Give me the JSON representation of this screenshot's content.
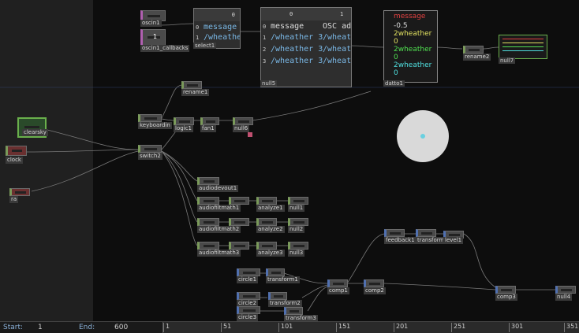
{
  "nodes": {
    "oscin1": "oscin1",
    "oscin1_callbacks": "oscin1_callbacks",
    "select1": "select1",
    "null5": "null5",
    "datto1": "datto1",
    "rename2": "rename2",
    "null7": "null7",
    "rename1": "rename1",
    "keyboardin": "keyboardin",
    "logic1": "logic1",
    "fan1": "fan1",
    "null6": "null6",
    "clearsky": "clearsky",
    "clock": "clock",
    "ra": "ra",
    "switch2": "switch2",
    "audiodevout1": "audiodevout1",
    "audiofiltmath1": "audiofiltmath1",
    "audiofiltmath2": "audiofiltmath2",
    "audiofiltmath3": "audiofiltmath3",
    "analyze1": "analyze1",
    "analyze2": "analyze2",
    "analyze3": "analyze3",
    "null1": "null1",
    "null2": "null2",
    "null3": "null3",
    "feedback1": "feedback1",
    "transform": "transform",
    "level1": "level1",
    "circle1": "circle1",
    "transform1": "transform1",
    "circle2": "circle2",
    "transform2": "transform2",
    "circle3": "circle3",
    "transform3": "transform3",
    "comp1": "comp1",
    "comp2": "comp2",
    "comp3": "comp3",
    "null4": "null4"
  },
  "select1_table": {
    "col": "0",
    "rows": [
      "message",
      "/wheather"
    ],
    "row_idx": [
      "0",
      "1"
    ]
  },
  "null5_table": {
    "cols": [
      "0",
      "1"
    ],
    "rows": [
      {
        "i": "0",
        "a": "message",
        "b": "OSC add"
      },
      {
        "i": "1",
        "a": "/wheather 3",
        "b": "/wheathe"
      },
      {
        "i": "2",
        "a": "/wheather 3",
        "b": "/wheathe"
      },
      {
        "i": "3",
        "a": "/wheather 3",
        "b": "/wheathe"
      }
    ]
  },
  "datto1_labels": [
    "message",
    "-0.5",
    "2wheather",
    "0",
    "2wheather",
    "0",
    "2wheather",
    "0"
  ],
  "oscin1_value": "1",
  "timeline": {
    "start_label": "Start:",
    "start_value": "1",
    "end_label": "End:",
    "end_value": "600",
    "ticks": [
      "1",
      "51",
      "101",
      "151",
      "201",
      "251",
      "301",
      "351"
    ]
  },
  "colors": {
    "chop_accent": "#7a9a5a",
    "dat_accent": "#b060b0",
    "top_accent": "#5070b0",
    "selected": "#6ab04c"
  }
}
